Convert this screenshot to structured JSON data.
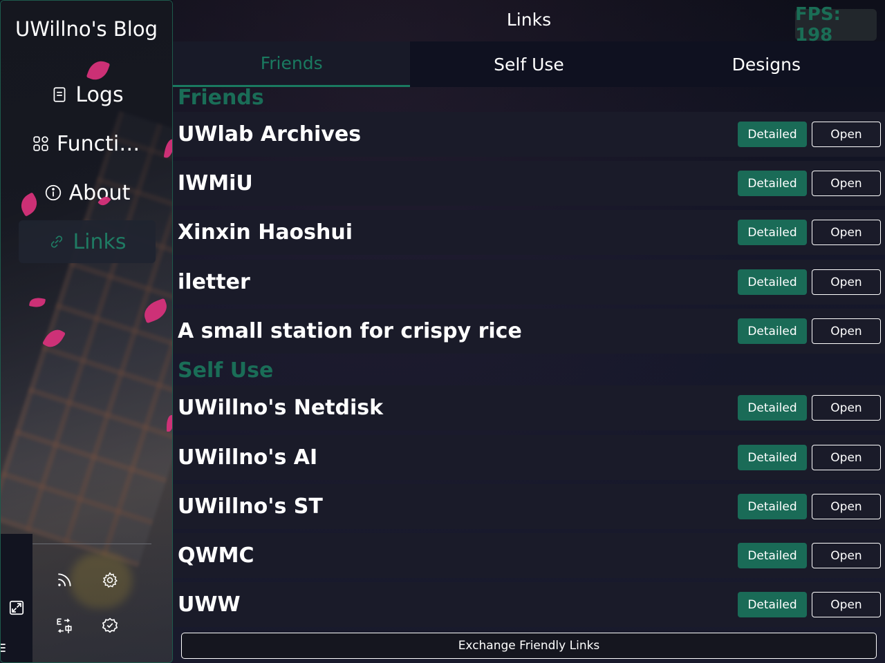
{
  "sidebar": {
    "blog_title": "UWillno's Blog",
    "nav": [
      {
        "label": "Logs",
        "icon": "document-icon",
        "active": false
      },
      {
        "label": "Functions",
        "icon": "grid-icon",
        "active": false
      },
      {
        "label": "About",
        "icon": "info-icon",
        "active": false
      },
      {
        "label": "Links",
        "icon": "link-icon",
        "active": true
      }
    ],
    "bottom_icons": [
      "expand-icon",
      "rss-icon",
      "gear-icon",
      "language-switch-icon",
      "settings-badge-icon"
    ]
  },
  "header": {
    "title": "Links",
    "fps_label": "FPS: 198"
  },
  "tabs": [
    {
      "label": "Friends",
      "active": true
    },
    {
      "label": "Self Use",
      "active": false
    },
    {
      "label": "Designs",
      "active": false
    }
  ],
  "sections": {
    "friends": {
      "heading": "Friends",
      "rows": [
        {
          "name": "UWlab Archives"
        },
        {
          "name": "IWMiU"
        },
        {
          "name": "Xinxin Haoshui"
        },
        {
          "name": "iletter"
        },
        {
          "name": "A small station for crispy rice"
        }
      ]
    },
    "self_use": {
      "heading": "Self Use",
      "rows": [
        {
          "name": "UWillno's Netdisk"
        },
        {
          "name": "UWillno's AI"
        },
        {
          "name": "UWillno's ST"
        },
        {
          "name": "QWMC"
        },
        {
          "name": "UWW"
        }
      ]
    }
  },
  "buttons": {
    "detailed_label": "Detailed",
    "open_label": "Open",
    "exchange_label": "Exchange Friendly Links"
  },
  "colors": {
    "accent": "#1a6b57",
    "background": "#131522",
    "row_background": "#1a1b29"
  }
}
